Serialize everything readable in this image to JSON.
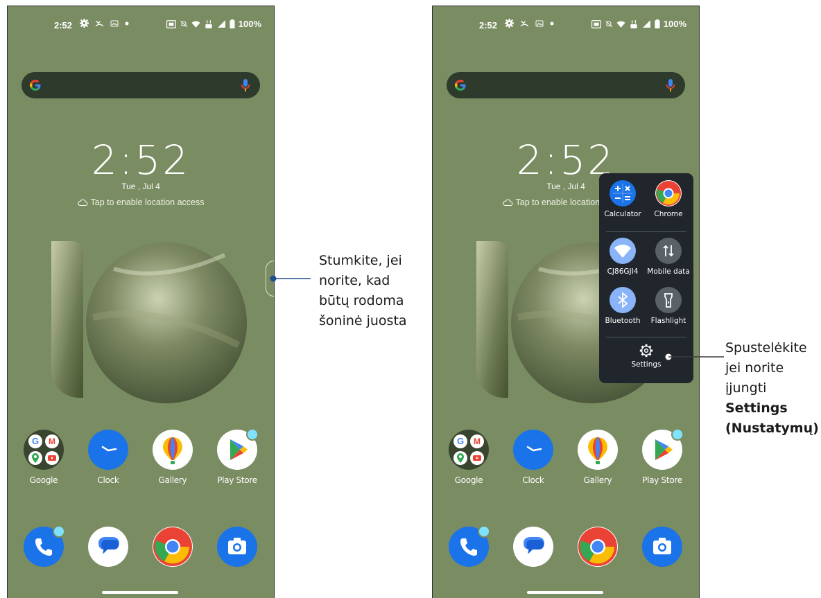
{
  "status": {
    "time": "2:52",
    "battery": "100%"
  },
  "home": {
    "big_clock": "2:52",
    "date": "Tue , Jul 4",
    "location_prompt": "Tap to enable location access"
  },
  "apps": [
    "Google",
    "Clock",
    "Gallery",
    "Play Store"
  ],
  "side_panel": {
    "calculator": "Calculator",
    "chrome": "Chrome",
    "wifi": "CJ86GJI4",
    "mobile_data": "Mobile data",
    "bluetooth": "Bluetooth",
    "flashlight": "Flashlight",
    "settings": "Settings"
  },
  "annotations": {
    "left": [
      "Stumkite, jei",
      "norite, kad",
      "būtų rodoma",
      "šoninė juosta"
    ],
    "right": [
      "Spustelėkite",
      "jei norite",
      "įjungti",
      "Settings",
      "(Nustatymų)"
    ]
  },
  "colors": {
    "wallpaper": "#7a8c62",
    "panel": "#20262c",
    "accent_blue": "#1a73e8"
  }
}
